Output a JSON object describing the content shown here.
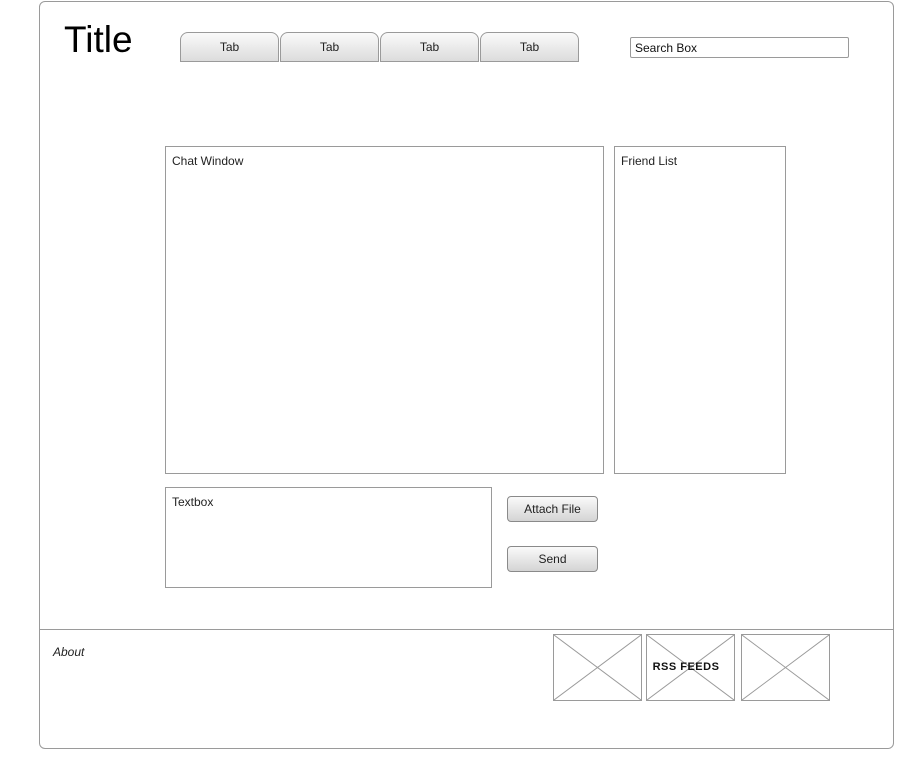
{
  "header": {
    "title": "Title",
    "tabs": [
      {
        "label": "Tab"
      },
      {
        "label": "Tab"
      },
      {
        "label": "Tab"
      },
      {
        "label": "Tab"
      }
    ],
    "search": {
      "value": "Search Box"
    }
  },
  "main": {
    "chat_window_label": "Chat Window",
    "friend_list_label": "Friend List",
    "textbox_label": "Textbox",
    "attach_file_label": "Attach File",
    "send_label": "Send"
  },
  "footer": {
    "about_label": "About",
    "rss_label": "RSS FEEDS"
  }
}
